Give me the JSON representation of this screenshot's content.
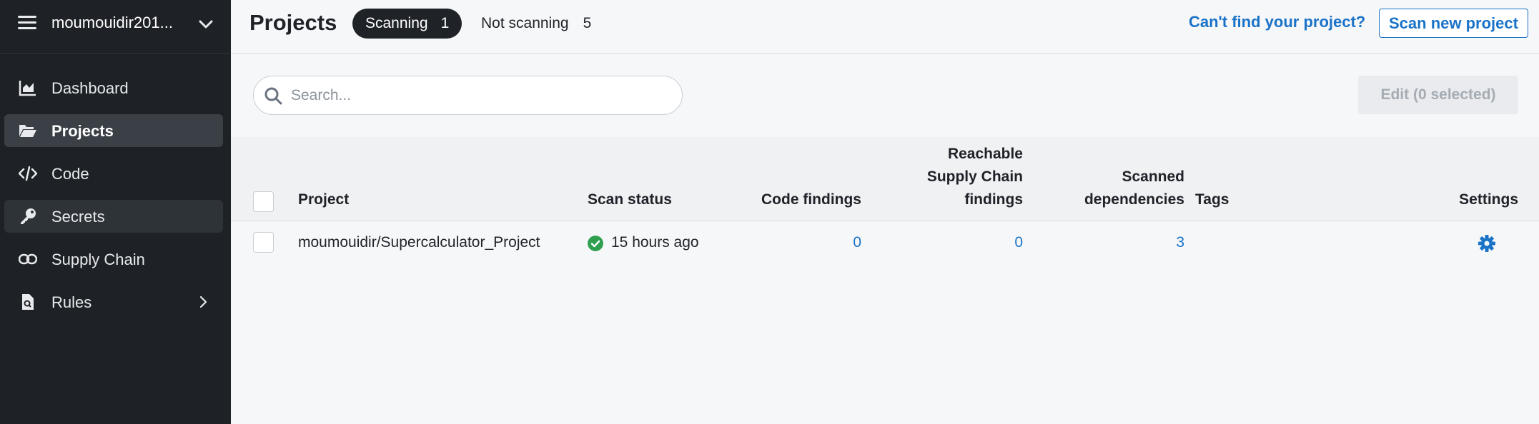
{
  "sidebar": {
    "org_name": "moumouidir201...",
    "items": [
      {
        "label": "Dashboard",
        "icon": "chart-area-icon",
        "state": "default"
      },
      {
        "label": "Projects",
        "icon": "folder-open-icon",
        "state": "active"
      },
      {
        "label": "Code",
        "icon": "code-icon",
        "state": "default"
      },
      {
        "label": "Secrets",
        "icon": "key-icon",
        "state": "hover"
      },
      {
        "label": "Supply Chain",
        "icon": "link-icon",
        "state": "default"
      },
      {
        "label": "Rules",
        "icon": "file-search-icon",
        "state": "default"
      }
    ]
  },
  "header": {
    "title": "Projects",
    "tabs": [
      {
        "label": "Scanning",
        "count": "1",
        "selected": true
      },
      {
        "label": "Not scanning",
        "count": "5",
        "selected": false
      }
    ],
    "cant_find_link": "Can't find your project?",
    "scan_new_button": "Scan new project"
  },
  "toolbar": {
    "search_placeholder": "Search...",
    "search_value": "",
    "edit_button": "Edit (0 selected)"
  },
  "table": {
    "columns": {
      "project": "Project",
      "scan_status": "Scan status",
      "code_findings": "Code findings",
      "reachable_line1": "Reachable",
      "reachable_line2": "Supply Chain",
      "reachable_line3": "findings",
      "scanned_line1": "Scanned",
      "scanned_line2": "dependencies",
      "tags": "Tags",
      "settings": "Settings"
    },
    "rows": [
      {
        "project": "moumouidir/Supercalculator_Project",
        "scan_status": "15 hours ago",
        "code_findings": "0",
        "reachable_findings": "0",
        "scanned_dependencies": "3",
        "tags": ""
      }
    ]
  },
  "colors": {
    "accent": "#1a73c7",
    "sidebar_bg": "#1e2226",
    "status_ok": "#2e9e4f"
  }
}
